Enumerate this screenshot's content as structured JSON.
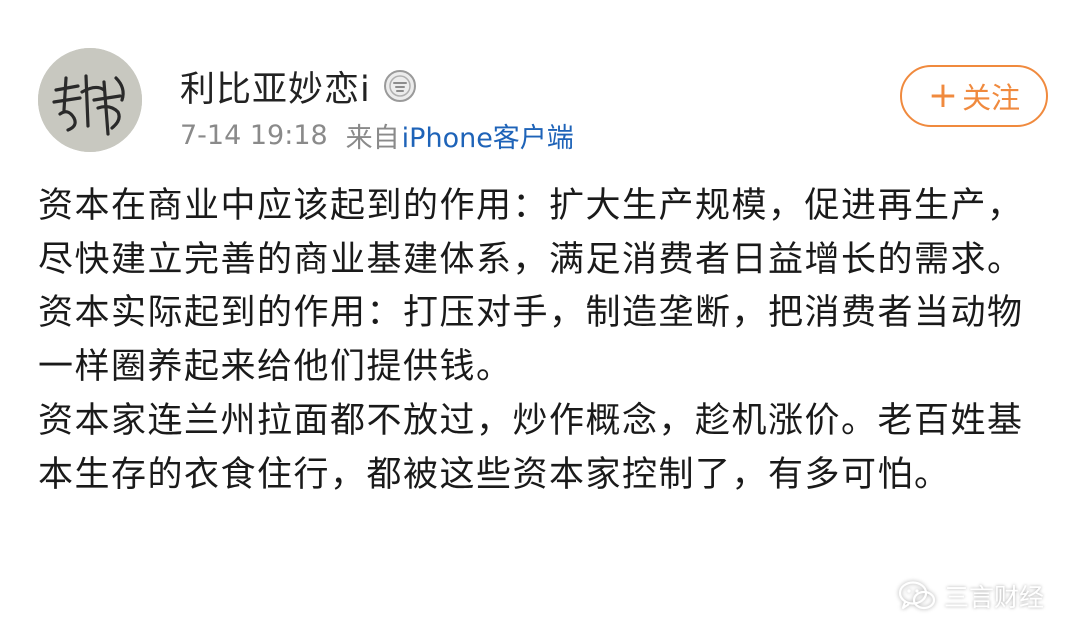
{
  "post": {
    "author": {
      "name": "利比亚妙恋i",
      "avatar_icon": "calligraphy-signature-avatar",
      "badge_icon": "verified-medal-icon"
    },
    "time": "7-14 19:18",
    "source_prefix": "来自",
    "source_client": "iPhone客户端",
    "follow_plus": "+",
    "follow_label": "关注",
    "paragraphs": [
      "资本在商业中应该起到的作用：扩大生产规模，促进再生产，尽快建立完善的商业基建体系，满足消费者日益增长的需求。",
      "资本实际起到的作用：打压对手，制造垄断，把消费者当动物一样圈养起来给他们提供钱。",
      "资本家连兰州拉面都不放过，炒作概念，趁机涨价。老百姓基本生存的衣食住行，都被这些资本家控制了，有多可怕。"
    ]
  },
  "watermark": {
    "text": "三言财经",
    "icon": "wechat-icon"
  },
  "colors": {
    "accent": "#f08a3e",
    "link": "#1e63b8",
    "meta": "#8a8a8a"
  }
}
